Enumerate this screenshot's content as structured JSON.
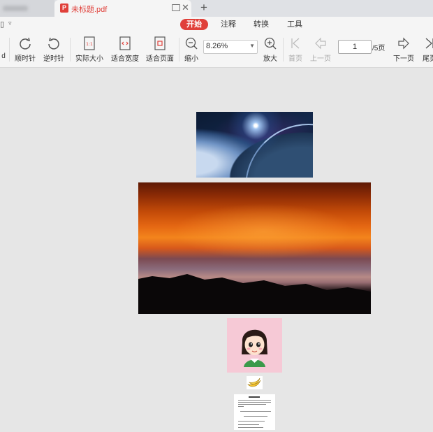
{
  "tabs": {
    "active_title": "未标题.pdf",
    "add_label": "+"
  },
  "menu": {
    "items": [
      {
        "label": "开始",
        "active": true
      },
      {
        "label": "注释",
        "active": false
      },
      {
        "label": "转换",
        "active": false
      },
      {
        "label": "工具",
        "active": false
      }
    ]
  },
  "toolbar": {
    "cut_label": "d",
    "rotate_cw": "顺时针",
    "rotate_ccw": "逆时针",
    "actual_size": "实际大小",
    "fit_width": "适合宽度",
    "fit_page": "适合页面",
    "zoom_out": "缩小",
    "zoom_value": "8.26%",
    "zoom_in": "放大",
    "first_page": "首页",
    "prev_page": "上一页",
    "current_page": "1",
    "page_total": "/5页",
    "next_page": "下一页",
    "last_page": "尾页"
  },
  "colors": {
    "accent": "#e0403a",
    "canvas": "#e6e6e6",
    "toolbar": "#f5f5f5"
  },
  "pages": {
    "count": 5
  }
}
